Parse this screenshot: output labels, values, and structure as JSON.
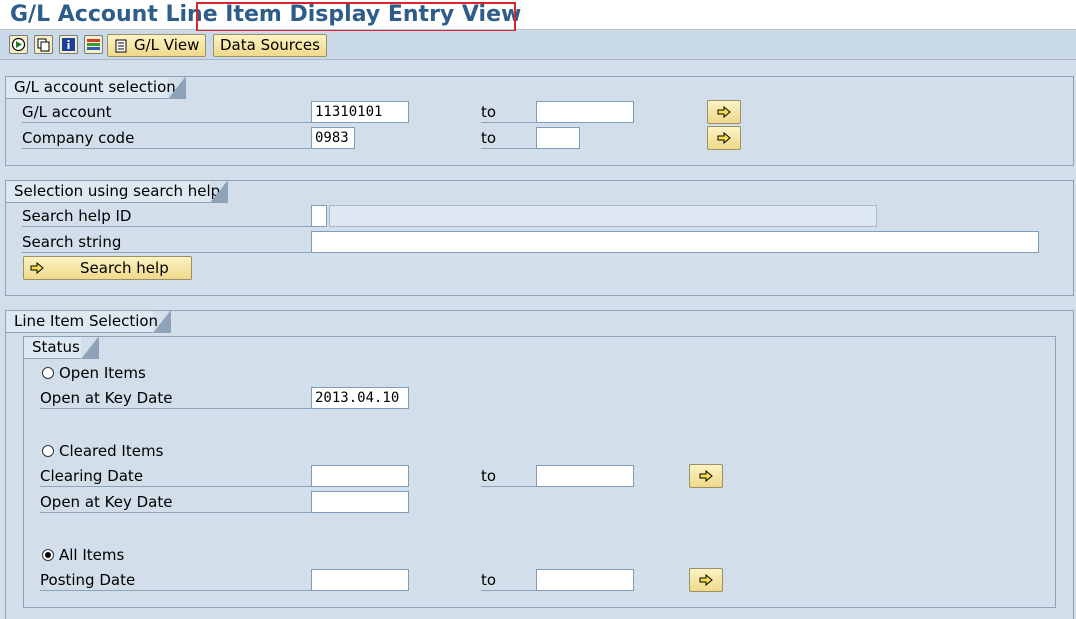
{
  "window": {
    "title": "G/L Account Line Item Display Entry View"
  },
  "toolbar": {
    "icons": [
      "execute-icon",
      "copy-icon",
      "info-icon",
      "layout-icon"
    ],
    "gl_view_label": "G/L View",
    "data_sources_label": "Data Sources"
  },
  "gl_account_selection": {
    "title": "G/L account selection",
    "gl_account_label": "G/L account",
    "gl_account_value": "11310101",
    "company_code_label": "Company code",
    "company_code_value": "0983",
    "to_label": "to"
  },
  "search_help": {
    "title": "Selection using search help",
    "id_label": "Search help ID",
    "string_label": "Search string",
    "button_label": "Search help"
  },
  "line_item_selection": {
    "title": "Line Item Selection",
    "status_title": "Status",
    "open_items_label": "Open Items",
    "open_key_date_label": "Open at Key Date",
    "open_key_date_value": "2013.04.10",
    "cleared_items_label": "Cleared Items",
    "clearing_date_label": "Clearing Date",
    "cleared_open_key_date_label": "Open at Key Date",
    "all_items_label": "All Items",
    "posting_date_label": "Posting Date",
    "to_label": "to",
    "selected_status": "All Items"
  },
  "colors": {
    "background": "#d2deea",
    "title": "#2f5d89",
    "highlight": "#d9262c",
    "button": "#efd98a"
  }
}
